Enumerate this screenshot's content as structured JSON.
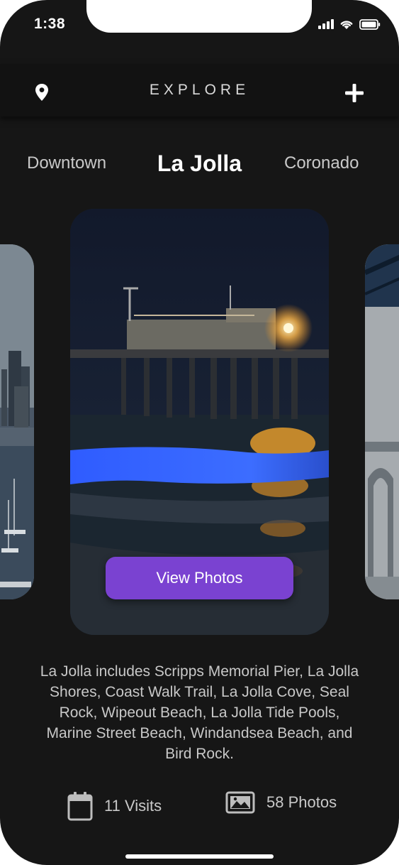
{
  "status_bar": {
    "time": "1:38"
  },
  "header": {
    "title": "EXPLORE"
  },
  "tabs": {
    "left": "Downtown",
    "active": "La Jolla",
    "right": "Coronado"
  },
  "card": {
    "button_label": "View Photos"
  },
  "description": "La Jolla includes Scripps Memorial Pier, La Jolla Shores, Coast Walk Trail, La Jolla Cove, Seal Rock, Wipeout Beach, La Jolla Tide Pools, Marine Street Beach, Windandsea Beach, and Bird Rock.",
  "stats": {
    "visits": "11 Visits",
    "photos": "58 Photos"
  },
  "icons": {
    "location": "location-pin-icon",
    "add": "plus-icon",
    "visits": "calendar-icon",
    "photos": "image-icon"
  },
  "colors": {
    "accent": "#7a42d1",
    "background": "#161616"
  }
}
